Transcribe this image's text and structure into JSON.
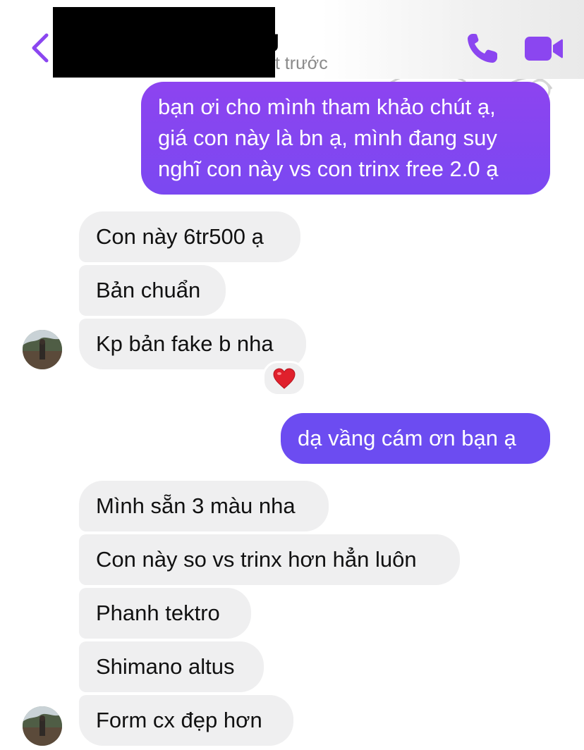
{
  "header": {
    "back_icon": "chevron-left-icon",
    "name_visible_fragment": "g",
    "status_visible_fragment": "út trước",
    "call_icon": "phone-icon",
    "video_icon": "video-camera-icon",
    "accent_color": "#8b46f0"
  },
  "messages": [
    {
      "side": "sent",
      "lines": [
        "bạn ơi cho mình tham khảo chút ạ,",
        "giá con này là bn ạ, mình đang suy",
        "nghĩ con này vs con trinx free 2.0 ạ"
      ]
    },
    {
      "side": "received",
      "text": "Con này 6tr500 ạ"
    },
    {
      "side": "received",
      "text": "Bản chuẩn"
    },
    {
      "side": "received",
      "text": "Kp bản fake b nha",
      "reaction": "❤️"
    },
    {
      "side": "sent",
      "text": "dạ vầng cám ơn bạn ạ"
    },
    {
      "side": "received",
      "text": "Mình sẵn 3 màu nha"
    },
    {
      "side": "received",
      "text": "Con này so vs trinx hơn hẳn luôn"
    },
    {
      "side": "received",
      "text": "Phanh tektro"
    },
    {
      "side": "received",
      "text": "Shimano altus"
    },
    {
      "side": "received",
      "text": "Form cx đẹp hơn"
    }
  ],
  "colors": {
    "sent_bubble_top": "#8a44f0",
    "sent_bubble_bottom": "#6a4cf2",
    "received_bubble": "#efeff0"
  }
}
